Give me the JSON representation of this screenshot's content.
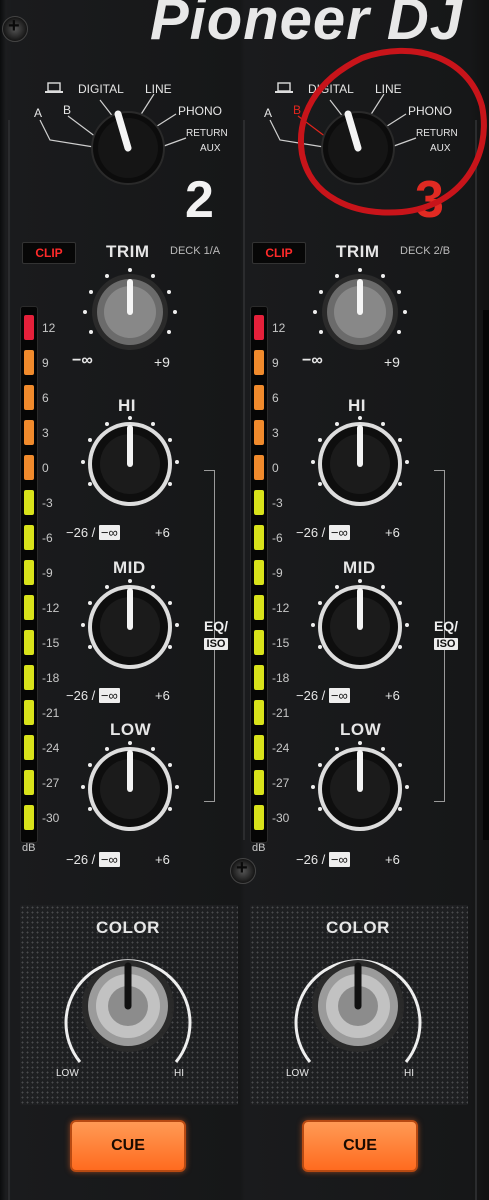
{
  "brand": "Pioneer DJ",
  "channels": [
    {
      "number": "2",
      "input_labels": {
        "a": "A",
        "b": "B",
        "digital": "DIGITAL",
        "line": "LINE",
        "phono": "PHONO",
        "return": "RETURN",
        "aux": "AUX"
      },
      "input_selected": "LINE",
      "clip": "CLIP",
      "trim": {
        "label": "TRIM",
        "min": "−∞",
        "max": "+9"
      },
      "deck": "DECK 1/A",
      "hi": {
        "label": "HI",
        "min": "−26 /",
        "min_box": "−∞",
        "max": "+6"
      },
      "mid": {
        "label": "MID",
        "min": "−26 /",
        "min_box": "−∞",
        "max": "+6"
      },
      "low": {
        "label": "LOW",
        "min": "−26 /",
        "min_box": "−∞",
        "max": "+6"
      },
      "meter_ticks": [
        "12",
        "9",
        "6",
        "3",
        "0",
        "-3",
        "-6",
        "-9",
        "-12",
        "-15",
        "-18",
        "-21",
        "-24",
        "-27",
        "-30"
      ],
      "meter_unit": "dB",
      "eq_label": "EQ/",
      "iso_label": "ISO",
      "color": {
        "label": "COLOR",
        "low": "LOW",
        "hi": "HI"
      },
      "cue": "CUE"
    },
    {
      "number": "3",
      "input_labels": {
        "a": "A",
        "b": "B",
        "digital": "DIGITAL",
        "line": "LINE",
        "phono": "PHONO",
        "return": "RETURN",
        "aux": "AUX"
      },
      "input_selected": "LINE",
      "clip": "CLIP",
      "trim": {
        "label": "TRIM",
        "min": "−∞",
        "max": "+9"
      },
      "deck": "DECK 2/B",
      "hi": {
        "label": "HI",
        "min": "−26 /",
        "min_box": "−∞",
        "max": "+6"
      },
      "mid": {
        "label": "MID",
        "min": "−26 /",
        "min_box": "−∞",
        "max": "+6"
      },
      "low": {
        "label": "LOW",
        "min": "−26 /",
        "min_box": "−∞",
        "max": "+6"
      },
      "meter_ticks": [
        "12",
        "9",
        "6",
        "3",
        "0",
        "-3",
        "-6",
        "-9",
        "-12",
        "-15",
        "-18",
        "-21",
        "-24",
        "-27",
        "-30"
      ],
      "meter_unit": "dB",
      "eq_label": "EQ/",
      "iso_label": "ISO",
      "color": {
        "label": "COLOR",
        "low": "LOW",
        "hi": "HI"
      },
      "cue": "CUE"
    }
  ],
  "colors": {
    "meter_red": "#e5203a",
    "meter_orange": "#f08a2c",
    "meter_yellow": "#d8e21a",
    "clip_red": "#ff2a2a",
    "cue_orange": "#ff7a2e",
    "annotation_red": "#c8141a",
    "highlight_b": "#e2251c"
  }
}
